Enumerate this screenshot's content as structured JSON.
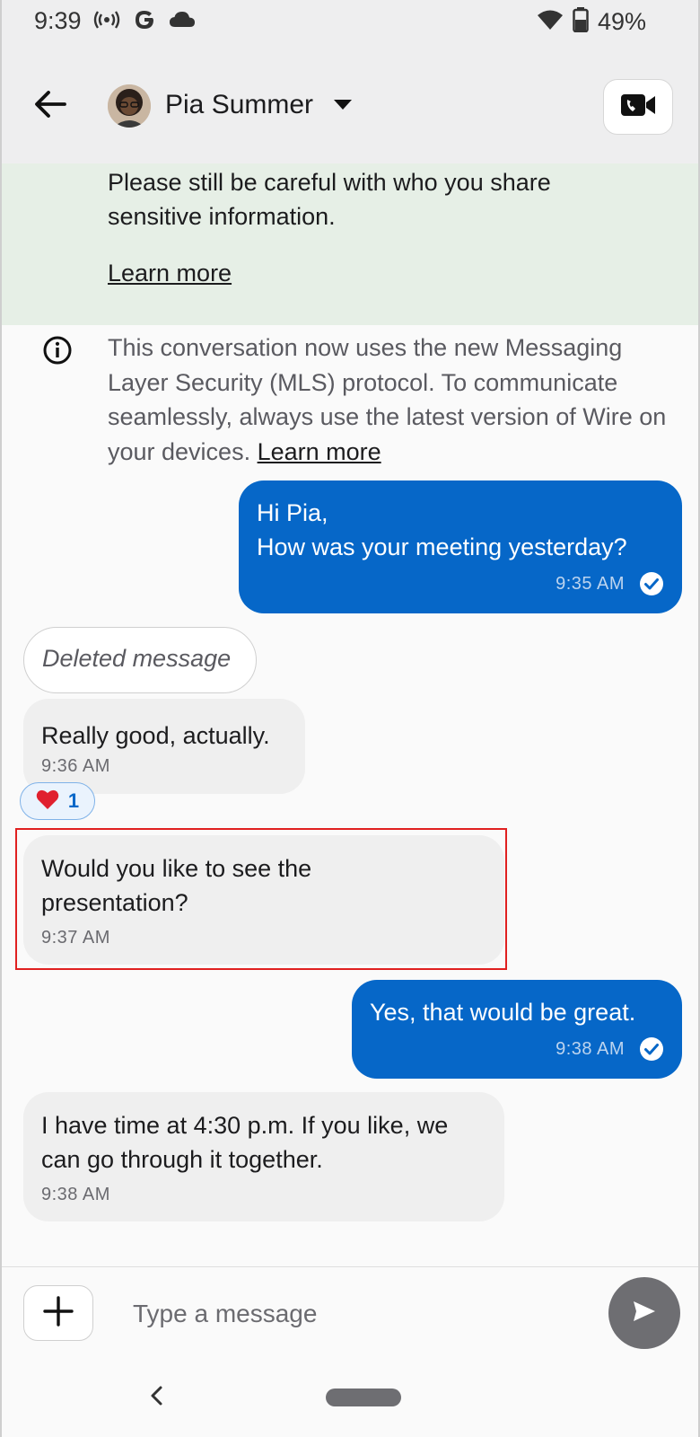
{
  "status_bar": {
    "time": "9:39",
    "battery": "49%",
    "left_icons": [
      "broadcast-icon",
      "google-g-icon",
      "cloud-icon"
    ],
    "right_icons": [
      "wifi-icon",
      "battery-icon"
    ]
  },
  "header": {
    "contact_name": "Pia Summer",
    "icons": {
      "back": "back-arrow-icon",
      "dropdown": "chevron-down-icon",
      "call": "video-call-icon"
    }
  },
  "banner": {
    "text": "Please still be careful with who you share sensitive information.",
    "link": "Learn more",
    "background": "#e6efe6"
  },
  "system_message": {
    "text": "This conversation now uses the new Messaging Layer Security (MLS) protocol. To communicate seamlessly, always use the latest version of Wire on your devices. ",
    "link": "Learn more",
    "icon": "info-icon"
  },
  "messages": [
    {
      "direction": "out",
      "text": "Hi Pia,\nHow was your meeting yesterday?",
      "time": "9:35 AM",
      "status": "delivered"
    },
    {
      "direction": "in",
      "deleted": true,
      "text": "Deleted message"
    },
    {
      "direction": "in",
      "text": "Really good, actually.",
      "time": "9:36 AM",
      "reaction": {
        "emoji": "❤️",
        "count": "1"
      }
    },
    {
      "direction": "in",
      "text": "Would you like to see the\npresentation?",
      "time": "9:37 AM",
      "highlighted": true
    },
    {
      "direction": "out",
      "text": "Yes, that would be great.",
      "time": "9:38 AM",
      "status": "delivered"
    },
    {
      "direction": "in",
      "text": "I have time at 4:30 p.m. If you like, we\ncan go through it together.",
      "time": "9:38 AM"
    }
  ],
  "composer": {
    "placeholder": "Type a message",
    "value": ""
  },
  "colors": {
    "outgoing_bubble": "#0667c8",
    "incoming_bubble": "#efefef",
    "highlight_border": "#e02020"
  }
}
